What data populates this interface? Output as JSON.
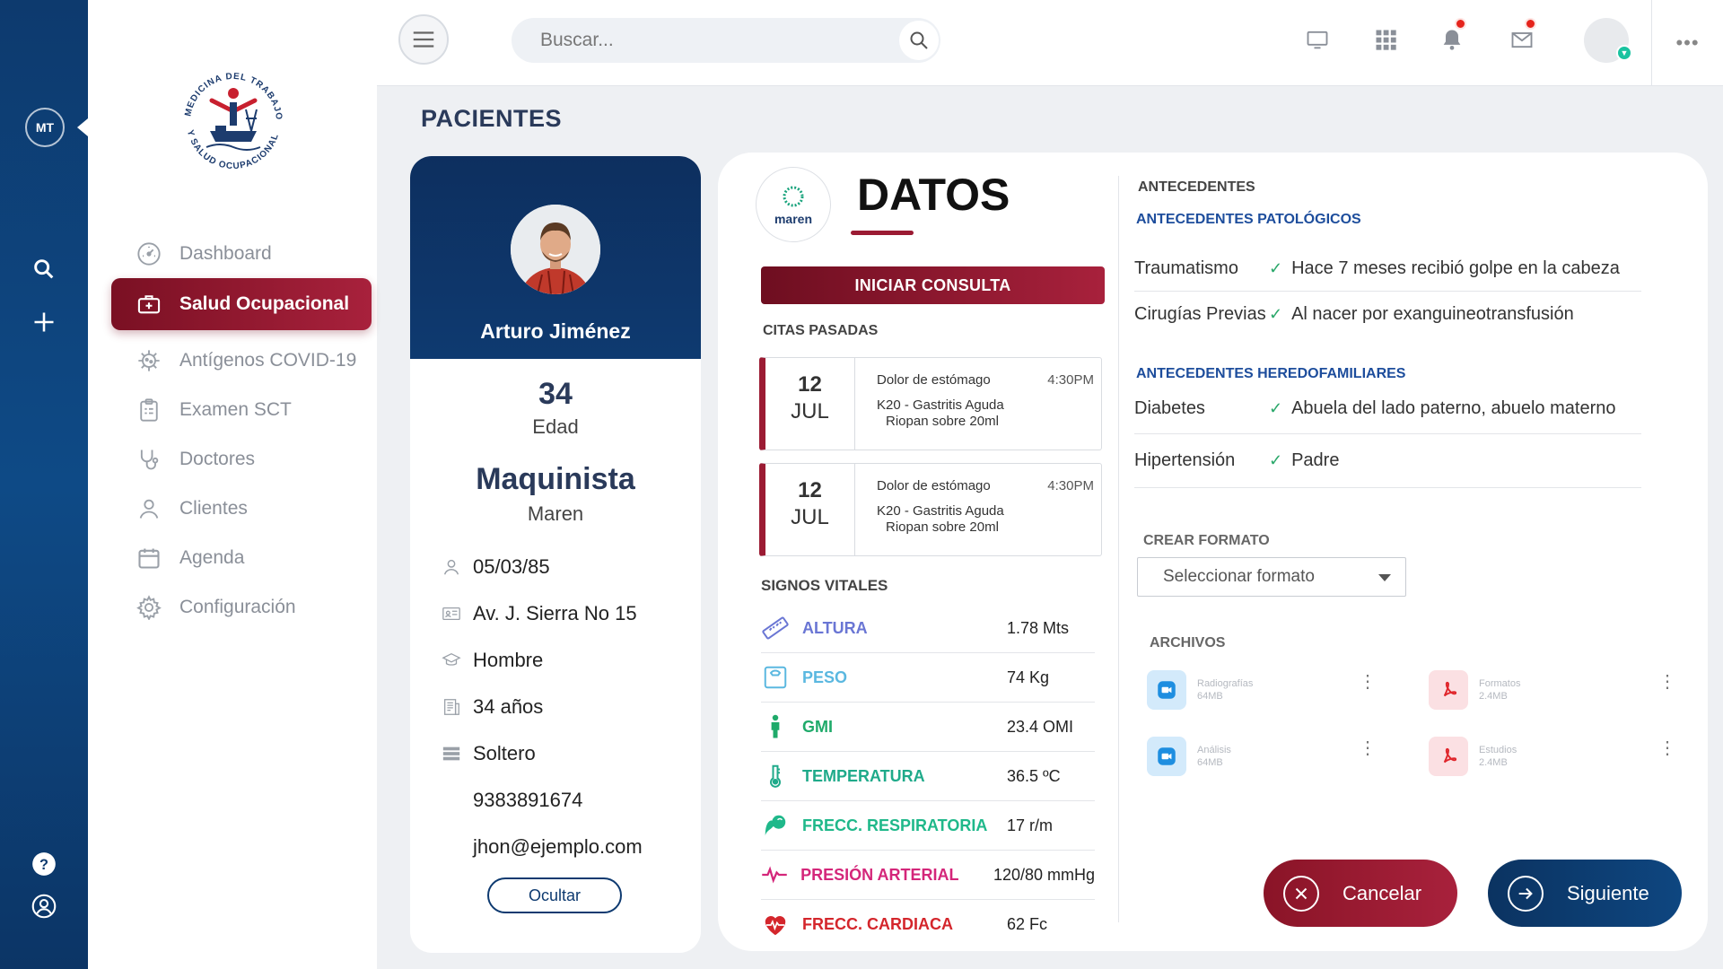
{
  "rail": {
    "logo_text": "MT"
  },
  "sidebar": {
    "brand_text_top": "MEDICINA DEL TRABAJO",
    "brand_text_bottom": "Y SALUD OCUPACIONAL",
    "items": [
      {
        "label": "Dashboard",
        "icon": "gauge-icon"
      },
      {
        "label": "Salud Ocupacional",
        "icon": "first-aid-kit-icon",
        "active": true
      },
      {
        "label": "Antígenos COVID-19",
        "icon": "virus-icon"
      },
      {
        "label": "Examen SCT",
        "icon": "clipboard-icon"
      },
      {
        "label": "Doctores",
        "icon": "stethoscope-icon"
      },
      {
        "label": "Clientes",
        "icon": "user-icon"
      },
      {
        "label": "Agenda",
        "icon": "calendar-icon"
      },
      {
        "label": "Configuración",
        "icon": "gear-icon"
      }
    ]
  },
  "topbar": {
    "search_placeholder": "Buscar...",
    "notification_dot_color": "#e5231b",
    "status_color": "#19c3a0",
    "more_label": "•••"
  },
  "page_title": "PACIENTES",
  "patient": {
    "name": "Arturo Jiménez",
    "age": "34",
    "age_label": "Edad",
    "occupation": "Maquinista",
    "company": "Maren",
    "birthdate": "05/03/85",
    "address": "Av. J. Sierra No 15",
    "gender": "Hombre",
    "years": "34 años",
    "marital_status": "Soltero",
    "phone": "9383891674",
    "email": "jhon@ejemplo.com",
    "hide_label": "Ocultar"
  },
  "datos": {
    "company_logo_text": "maren",
    "title": "DATOS",
    "start_button": "INICIAR CONSULTA",
    "past_label": "CITAS PASADAS",
    "appointments": [
      {
        "day": "12",
        "month": "JUL",
        "reason": "Dolor de estómago",
        "time": "4:30PM",
        "diagnosis": "K20 - Gastritis Aguda",
        "medication": "Riopan sobre 20ml"
      },
      {
        "day": "12",
        "month": "JUL",
        "reason": "Dolor de estómago",
        "time": "4:30PM",
        "diagnosis": "K20 - Gastritis Aguda",
        "medication": "Riopan sobre 20ml"
      }
    ],
    "vitals_label": "SIGNOS VITALES",
    "vitals": [
      {
        "name": "ALTURA",
        "value": "1.78 Mts",
        "color": "#6a76d4",
        "icon": "ruler-icon"
      },
      {
        "name": "PESO",
        "value": "74 Kg",
        "color": "#5bb8e0",
        "icon": "scale-icon"
      },
      {
        "name": "GMI",
        "value": "23.4 OMI",
        "color": "#1faa6a",
        "icon": "person-icon"
      },
      {
        "name": "TEMPERATURA",
        "value": "36.5 ºC",
        "color": "#1faa8a",
        "icon": "thermometer-icon"
      },
      {
        "name": "FRECC. RESPIRATORIA",
        "value": "17 r/m",
        "color": "#1fb88a",
        "icon": "lungs-icon"
      },
      {
        "name": "PRESIÓN ARTERIAL",
        "value": "120/80 mmHg",
        "color": "#d4267a",
        "icon": "pulse-icon"
      },
      {
        "name": "FRECC. CARDIACA",
        "value": "62 Fc",
        "color": "#d4262c",
        "icon": "heart-icon"
      }
    ]
  },
  "antecedentes": {
    "title": "ANTECEDENTES",
    "pathological_title": "ANTECEDENTES PATOLÓGICOS",
    "pathological": [
      {
        "key": "Traumatismo",
        "value": "Hace 7 meses recibió golpe en la cabeza"
      },
      {
        "key": "Cirugías Previas",
        "value": "Al nacer por exanguineotransfusión"
      }
    ],
    "hereditary_title": "ANTECEDENTES HEREDOFAMILIARES",
    "hereditary": [
      {
        "key": "Diabetes",
        "value": "Abuela del lado paterno, abuelo materno"
      },
      {
        "key": "Hipertensión",
        "value": "Padre"
      }
    ],
    "check": "✓"
  },
  "crear_formato": {
    "label": "CREAR FORMATO",
    "select_value": "Seleccionar formato"
  },
  "archivos": {
    "label": "ARCHIVOS",
    "files": [
      {
        "name": "Radiografías",
        "size": "64MB",
        "type": "video"
      },
      {
        "name": "Formatos",
        "size": "2.4MB",
        "type": "pdf"
      },
      {
        "name": "Análisis",
        "size": "64MB",
        "type": "video"
      },
      {
        "name": "Estudios",
        "size": "2.4MB",
        "type": "pdf"
      }
    ]
  },
  "actions": {
    "cancel": "Cancelar",
    "next": "Siguiente"
  }
}
